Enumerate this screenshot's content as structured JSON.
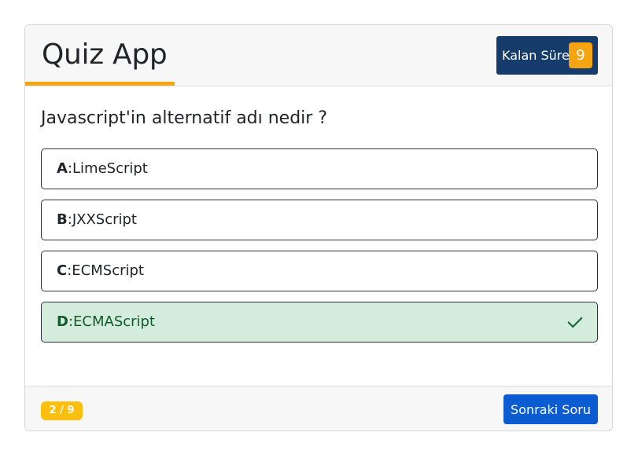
{
  "header": {
    "title": "Quiz App",
    "timer_label": "Kalan Süre",
    "timer_value": "9"
  },
  "question": {
    "text": "Javascript'in alternatif adı nedir ?",
    "options": [
      {
        "letter": "A",
        "separator": ":",
        "text": "LimeScript",
        "state": "default"
      },
      {
        "letter": "B",
        "separator": ":",
        "text": "JXXScript",
        "state": "default"
      },
      {
        "letter": "C",
        "separator": ":",
        "text": "ECMScript",
        "state": "default"
      },
      {
        "letter": "D",
        "separator": ":",
        "text": "ECMAScript",
        "state": "correct",
        "icon": "check-icon"
      }
    ]
  },
  "footer": {
    "progress": "2 / 9",
    "next_label": "Sonraki Soru"
  },
  "colors": {
    "accent": "#f2a515",
    "timer_bg": "#153c6a",
    "correct_bg": "#d3ecdc",
    "correct_text": "#125a2e",
    "button": "#0b5bd1",
    "badge": "#fbbf10"
  }
}
